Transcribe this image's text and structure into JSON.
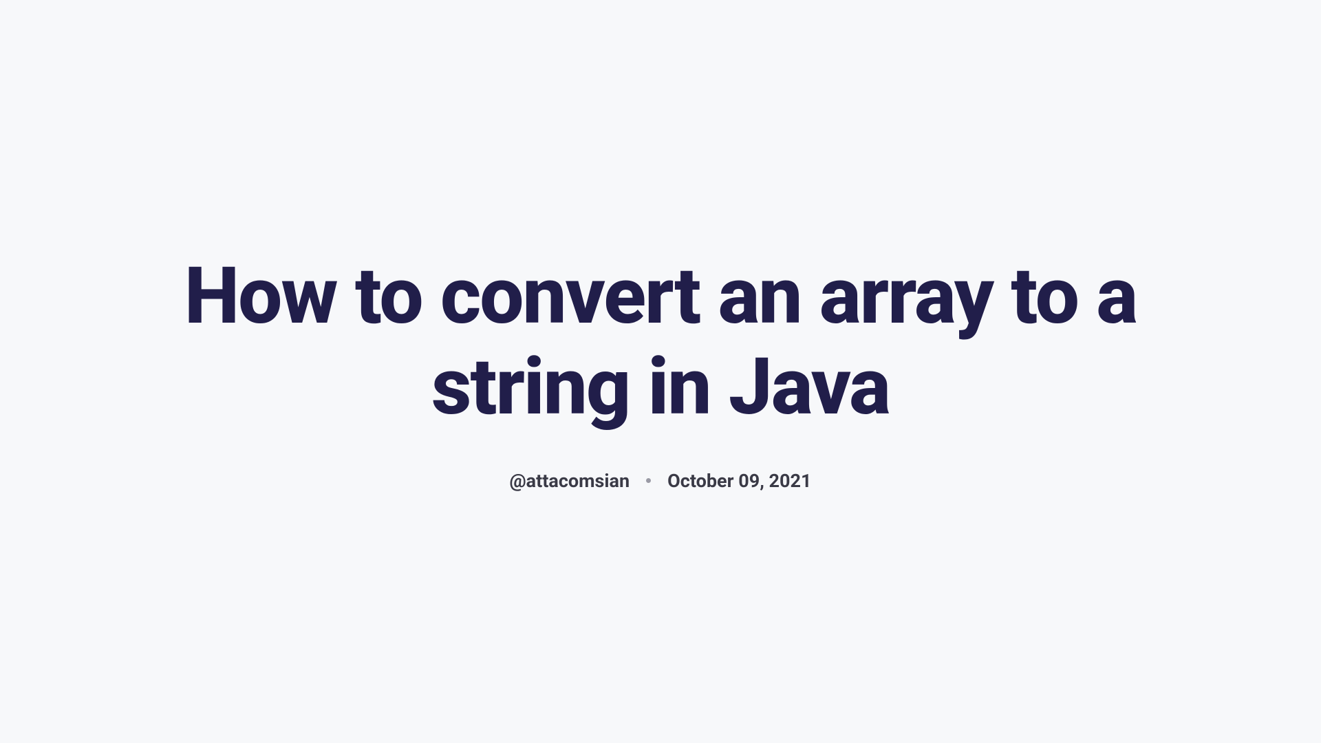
{
  "title": "How to convert an array to a string in Java",
  "author": "@attacomsian",
  "date": "October 09, 2021"
}
